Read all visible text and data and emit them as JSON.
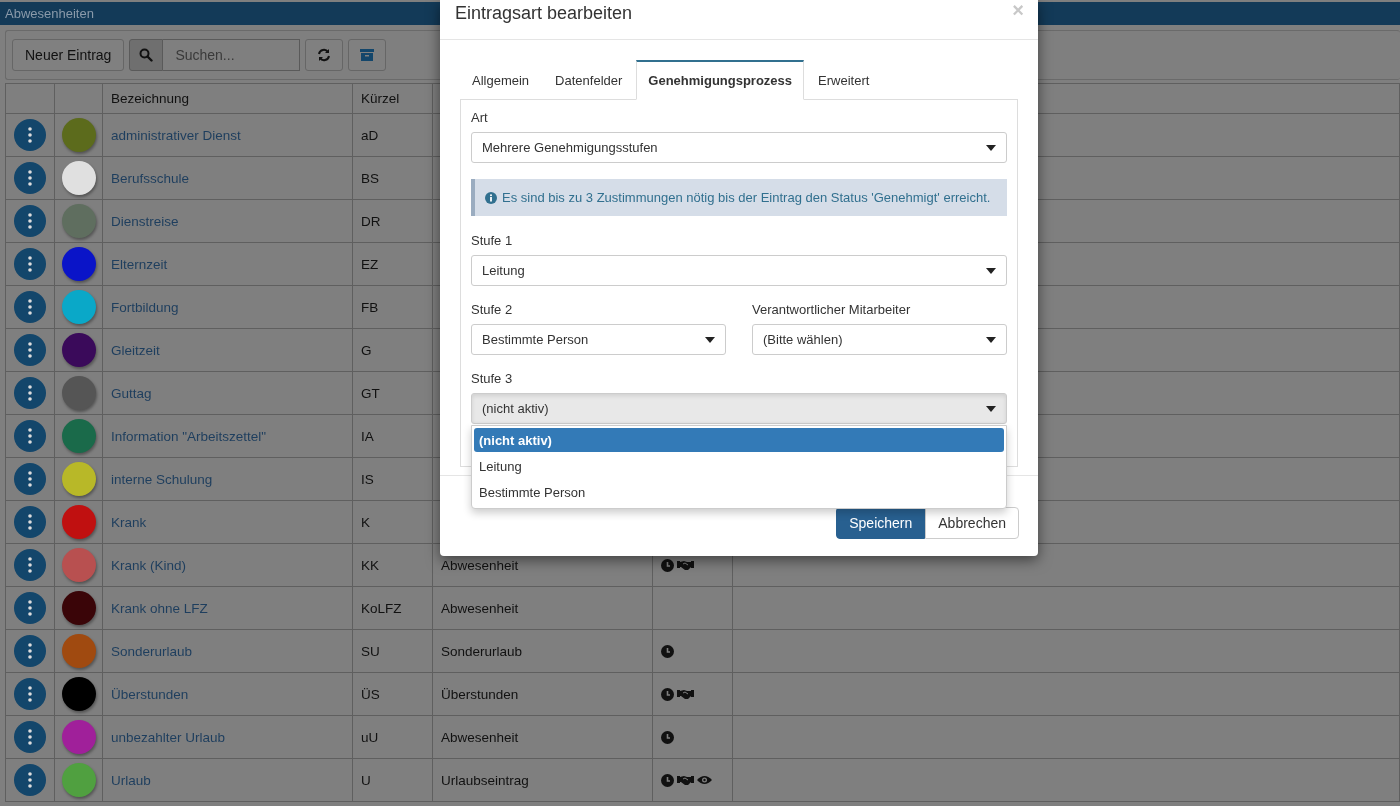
{
  "page": {
    "title": "Abwesenheiten"
  },
  "toolbar": {
    "new_button": "Neuer Eintrag",
    "search": {
      "placeholder": "Suchen..."
    }
  },
  "table": {
    "columns": [
      "Bezeichnung",
      "Kürzel"
    ],
    "rows": [
      {
        "name": "administrativer Dienst",
        "code": "aD",
        "color": "#5c6b1c"
      },
      {
        "name": "Berufsschule",
        "code": "BS",
        "color": "#e0e0e0"
      },
      {
        "name": "Dienstreise",
        "code": "DR",
        "color": "#5f6e5f"
      },
      {
        "name": "Elternzeit",
        "code": "EZ",
        "color": "#0a14c8"
      },
      {
        "name": "Fortbildung",
        "code": "FB",
        "color": "#0aa8c8"
      },
      {
        "name": "Gleitzeit",
        "code": "G",
        "color": "#3a0a5a"
      },
      {
        "name": "Guttag",
        "code": "GT",
        "color": "#555555"
      },
      {
        "name": "Information \"Arbeitszettel\"",
        "code": "IA",
        "color": "#1a6a4a"
      },
      {
        "name": "interne Schulung",
        "code": "IS",
        "color": "#b8b828"
      },
      {
        "name": "Krank",
        "code": "K",
        "color": "#c01010"
      },
      {
        "name": "Krank (Kind)",
        "code": "KK",
        "color": "#b85050",
        "type": "Abwesenheit",
        "icons": [
          {
            "kind": "clock"
          },
          {
            "kind": "handshake"
          }
        ]
      },
      {
        "name": "Krank ohne LFZ",
        "code": "KoLFZ",
        "color": "#3a0508",
        "type": "Abwesenheit"
      },
      {
        "name": "Sonderurlaub",
        "code": "SU",
        "color": "#a04a10",
        "type": "Sonderurlaub",
        "icons": [
          {
            "kind": "clock"
          }
        ]
      },
      {
        "name": "Überstunden",
        "code": "ÜS",
        "color": "#000000",
        "type": "Überstunden",
        "icons": [
          {
            "kind": "clock"
          },
          {
            "kind": "handshake"
          }
        ]
      },
      {
        "name": "unbezahlter Urlaub",
        "code": "uU",
        "color": "#a0209a",
        "type": "Abwesenheit",
        "icons": [
          {
            "kind": "clock"
          }
        ]
      },
      {
        "name": "Urlaub",
        "code": "U",
        "color": "#50a040",
        "type": "Urlaubseintrag",
        "icons": [
          {
            "kind": "clock"
          },
          {
            "kind": "handshake"
          },
          {
            "kind": "eye"
          }
        ]
      }
    ]
  },
  "dialog": {
    "title": "Eintragsart bearbeiten",
    "close": "×",
    "tabs": [
      {
        "label": "Allgemein",
        "selected": false
      },
      {
        "label": "Datenfelder",
        "selected": false
      },
      {
        "label": "Genehmigungsprozess",
        "selected": true
      },
      {
        "label": "Erweitert",
        "selected": false
      }
    ],
    "form": [
      {
        "kind": "select",
        "fields": [
          {
            "label": "Art",
            "value": "Mehrere Genehmigungsstufen",
            "expanded": false
          }
        ]
      },
      {
        "kind": "info",
        "text": "Es sind bis zu 3 Zustimmungen nötig bis der Eintrag den Status 'Genehmigt' erreicht."
      },
      {
        "kind": "select",
        "fields": [
          {
            "label": "Stufe 1",
            "value": "Leitung",
            "expanded": false
          }
        ]
      },
      {
        "kind": "select",
        "fields": [
          {
            "label": "Stufe 2",
            "value": "Bestimmte Person",
            "expanded": false
          },
          {
            "label": "Verantwortlicher Mitarbeiter",
            "value": "(Bitte wählen)",
            "expanded": false
          }
        ]
      },
      {
        "kind": "select",
        "fields": [
          {
            "label": "Stufe 3",
            "value": "(nicht aktiv)",
            "expanded": true,
            "options": [
              {
                "label": "(nicht aktiv)",
                "selected": true
              },
              {
                "label": "Leitung",
                "selected": false
              },
              {
                "label": "Bestimmte Person",
                "selected": false
              }
            ]
          }
        ]
      }
    ],
    "buttons": [
      {
        "label": "Speichern",
        "kind": "primary"
      },
      {
        "label": "Abbrechen",
        "kind": "default"
      }
    ]
  }
}
